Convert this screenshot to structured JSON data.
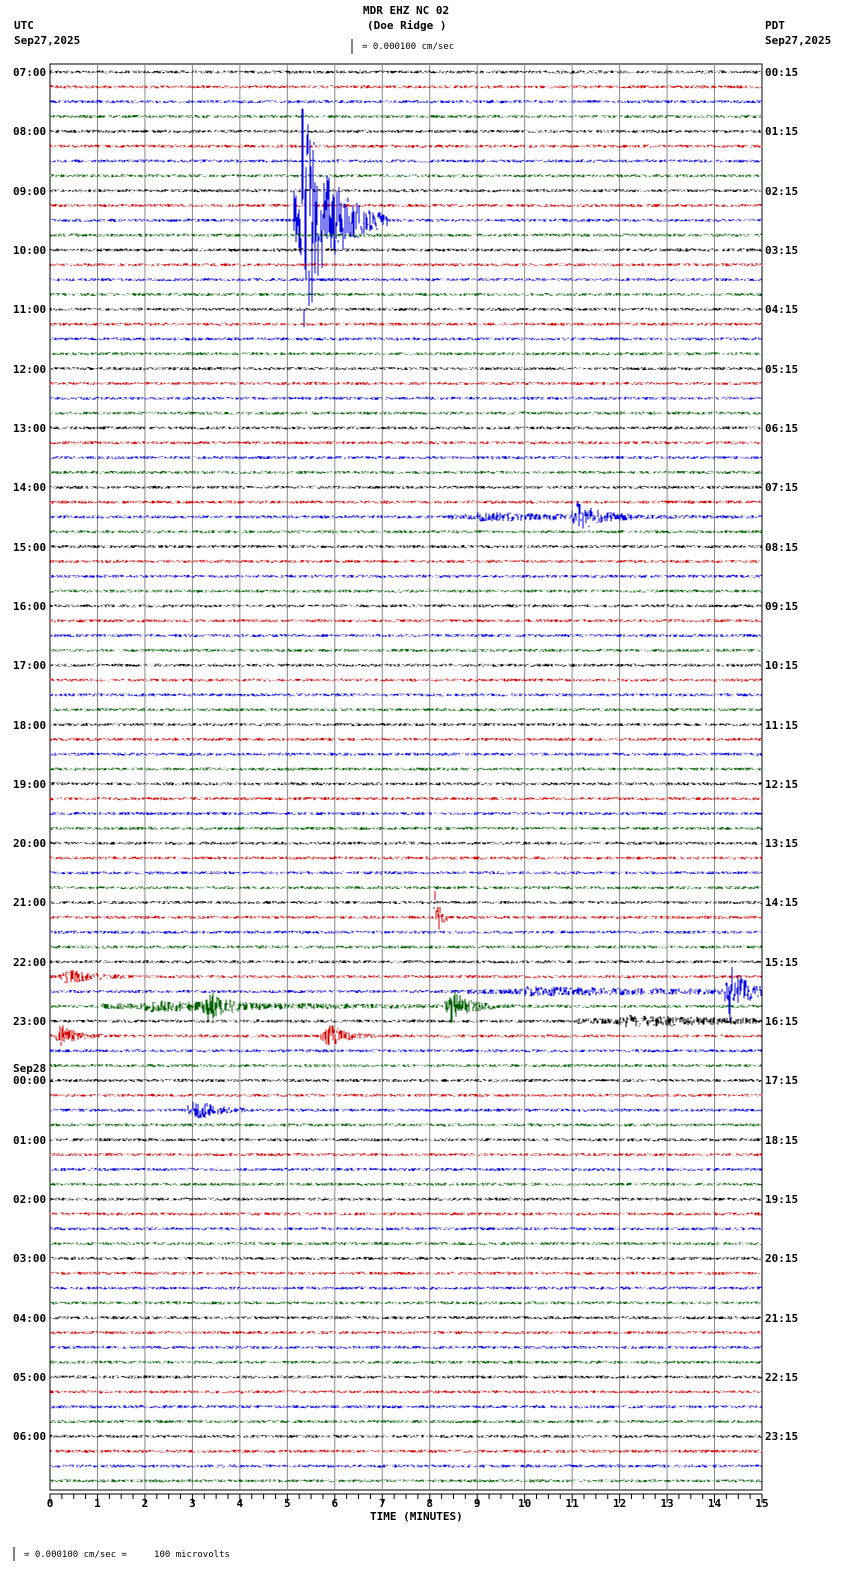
{
  "header": {
    "title": "MDR EHZ NC 02",
    "subtitle": "(Doe Ridge )",
    "left_tz": "UTC",
    "left_date": "Sep27,2025",
    "right_tz": "PDT",
    "right_date": "Sep27,2025",
    "scale": "= 0.000100 cm/sec"
  },
  "footer": {
    "scale": "= 0.000100 cm/sec =     100 microvolts"
  },
  "chart_data": {
    "type": "line",
    "title": "MDR EHZ NC 02 (Doe Ridge )",
    "xlabel": "TIME (MINUTES)",
    "xlim": [
      0,
      15
    ],
    "x_ticks": [
      "0",
      "1",
      "2",
      "3",
      "4",
      "5",
      "6",
      "7",
      "8",
      "9",
      "10",
      "11",
      "12",
      "13",
      "14",
      "15"
    ],
    "traces_per_hour": 4,
    "trace_minutes": 15,
    "trace_colors": [
      "#000000",
      "#d00000",
      "#0000e0",
      "#006000"
    ],
    "left_labels": [
      "07:00",
      "08:00",
      "09:00",
      "10:00",
      "11:00",
      "12:00",
      "13:00",
      "14:00",
      "15:00",
      "16:00",
      "17:00",
      "18:00",
      "19:00",
      "20:00",
      "21:00",
      "22:00",
      "23:00",
      "00:00",
      "01:00",
      "02:00",
      "03:00",
      "04:00",
      "05:00",
      "06:00"
    ],
    "date_change_label": "Sep28",
    "right_labels": [
      "00:15",
      "01:15",
      "02:15",
      "03:15",
      "04:15",
      "05:15",
      "06:15",
      "07:15",
      "08:15",
      "09:15",
      "10:15",
      "11:15",
      "12:15",
      "13:15",
      "14:15",
      "15:15",
      "16:15",
      "17:15",
      "18:15",
      "19:15",
      "20:15",
      "21:15",
      "22:15",
      "23:15"
    ],
    "total_traces": 96,
    "events": [
      {
        "trace": 10,
        "minute": 5.3,
        "amplitude": 120,
        "duration": 1.2
      },
      {
        "trace": 30,
        "minute": 11.1,
        "amplitude": 14,
        "duration": 0.8
      },
      {
        "trace": 30,
        "minute": 9.0,
        "amplitude": 4,
        "duration": 4.0
      },
      {
        "trace": 57,
        "minute": 8.1,
        "amplitude": 30,
        "duration": 0.2
      },
      {
        "trace": 61,
        "minute": 0.3,
        "amplitude": 8,
        "duration": 1.0
      },
      {
        "trace": 62,
        "minute": 14.3,
        "amplitude": 30,
        "duration": 0.6
      },
      {
        "trace": 62,
        "minute": 10.0,
        "amplitude": 4,
        "duration": 8.0
      },
      {
        "trace": 63,
        "minute": 3.3,
        "amplitude": 14,
        "duration": 0.6
      },
      {
        "trace": 63,
        "minute": 8.4,
        "amplitude": 18,
        "duration": 0.7
      },
      {
        "trace": 63,
        "minute": 2.0,
        "amplitude": 5,
        "duration": 6.0
      },
      {
        "trace": 64,
        "minute": 12.0,
        "amplitude": 5,
        "duration": 6.0
      },
      {
        "trace": 65,
        "minute": 0.2,
        "amplitude": 12,
        "duration": 0.6
      },
      {
        "trace": 65,
        "minute": 5.8,
        "amplitude": 14,
        "duration": 0.7
      },
      {
        "trace": 70,
        "minute": 3.0,
        "amplitude": 12,
        "duration": 0.8
      }
    ]
  }
}
